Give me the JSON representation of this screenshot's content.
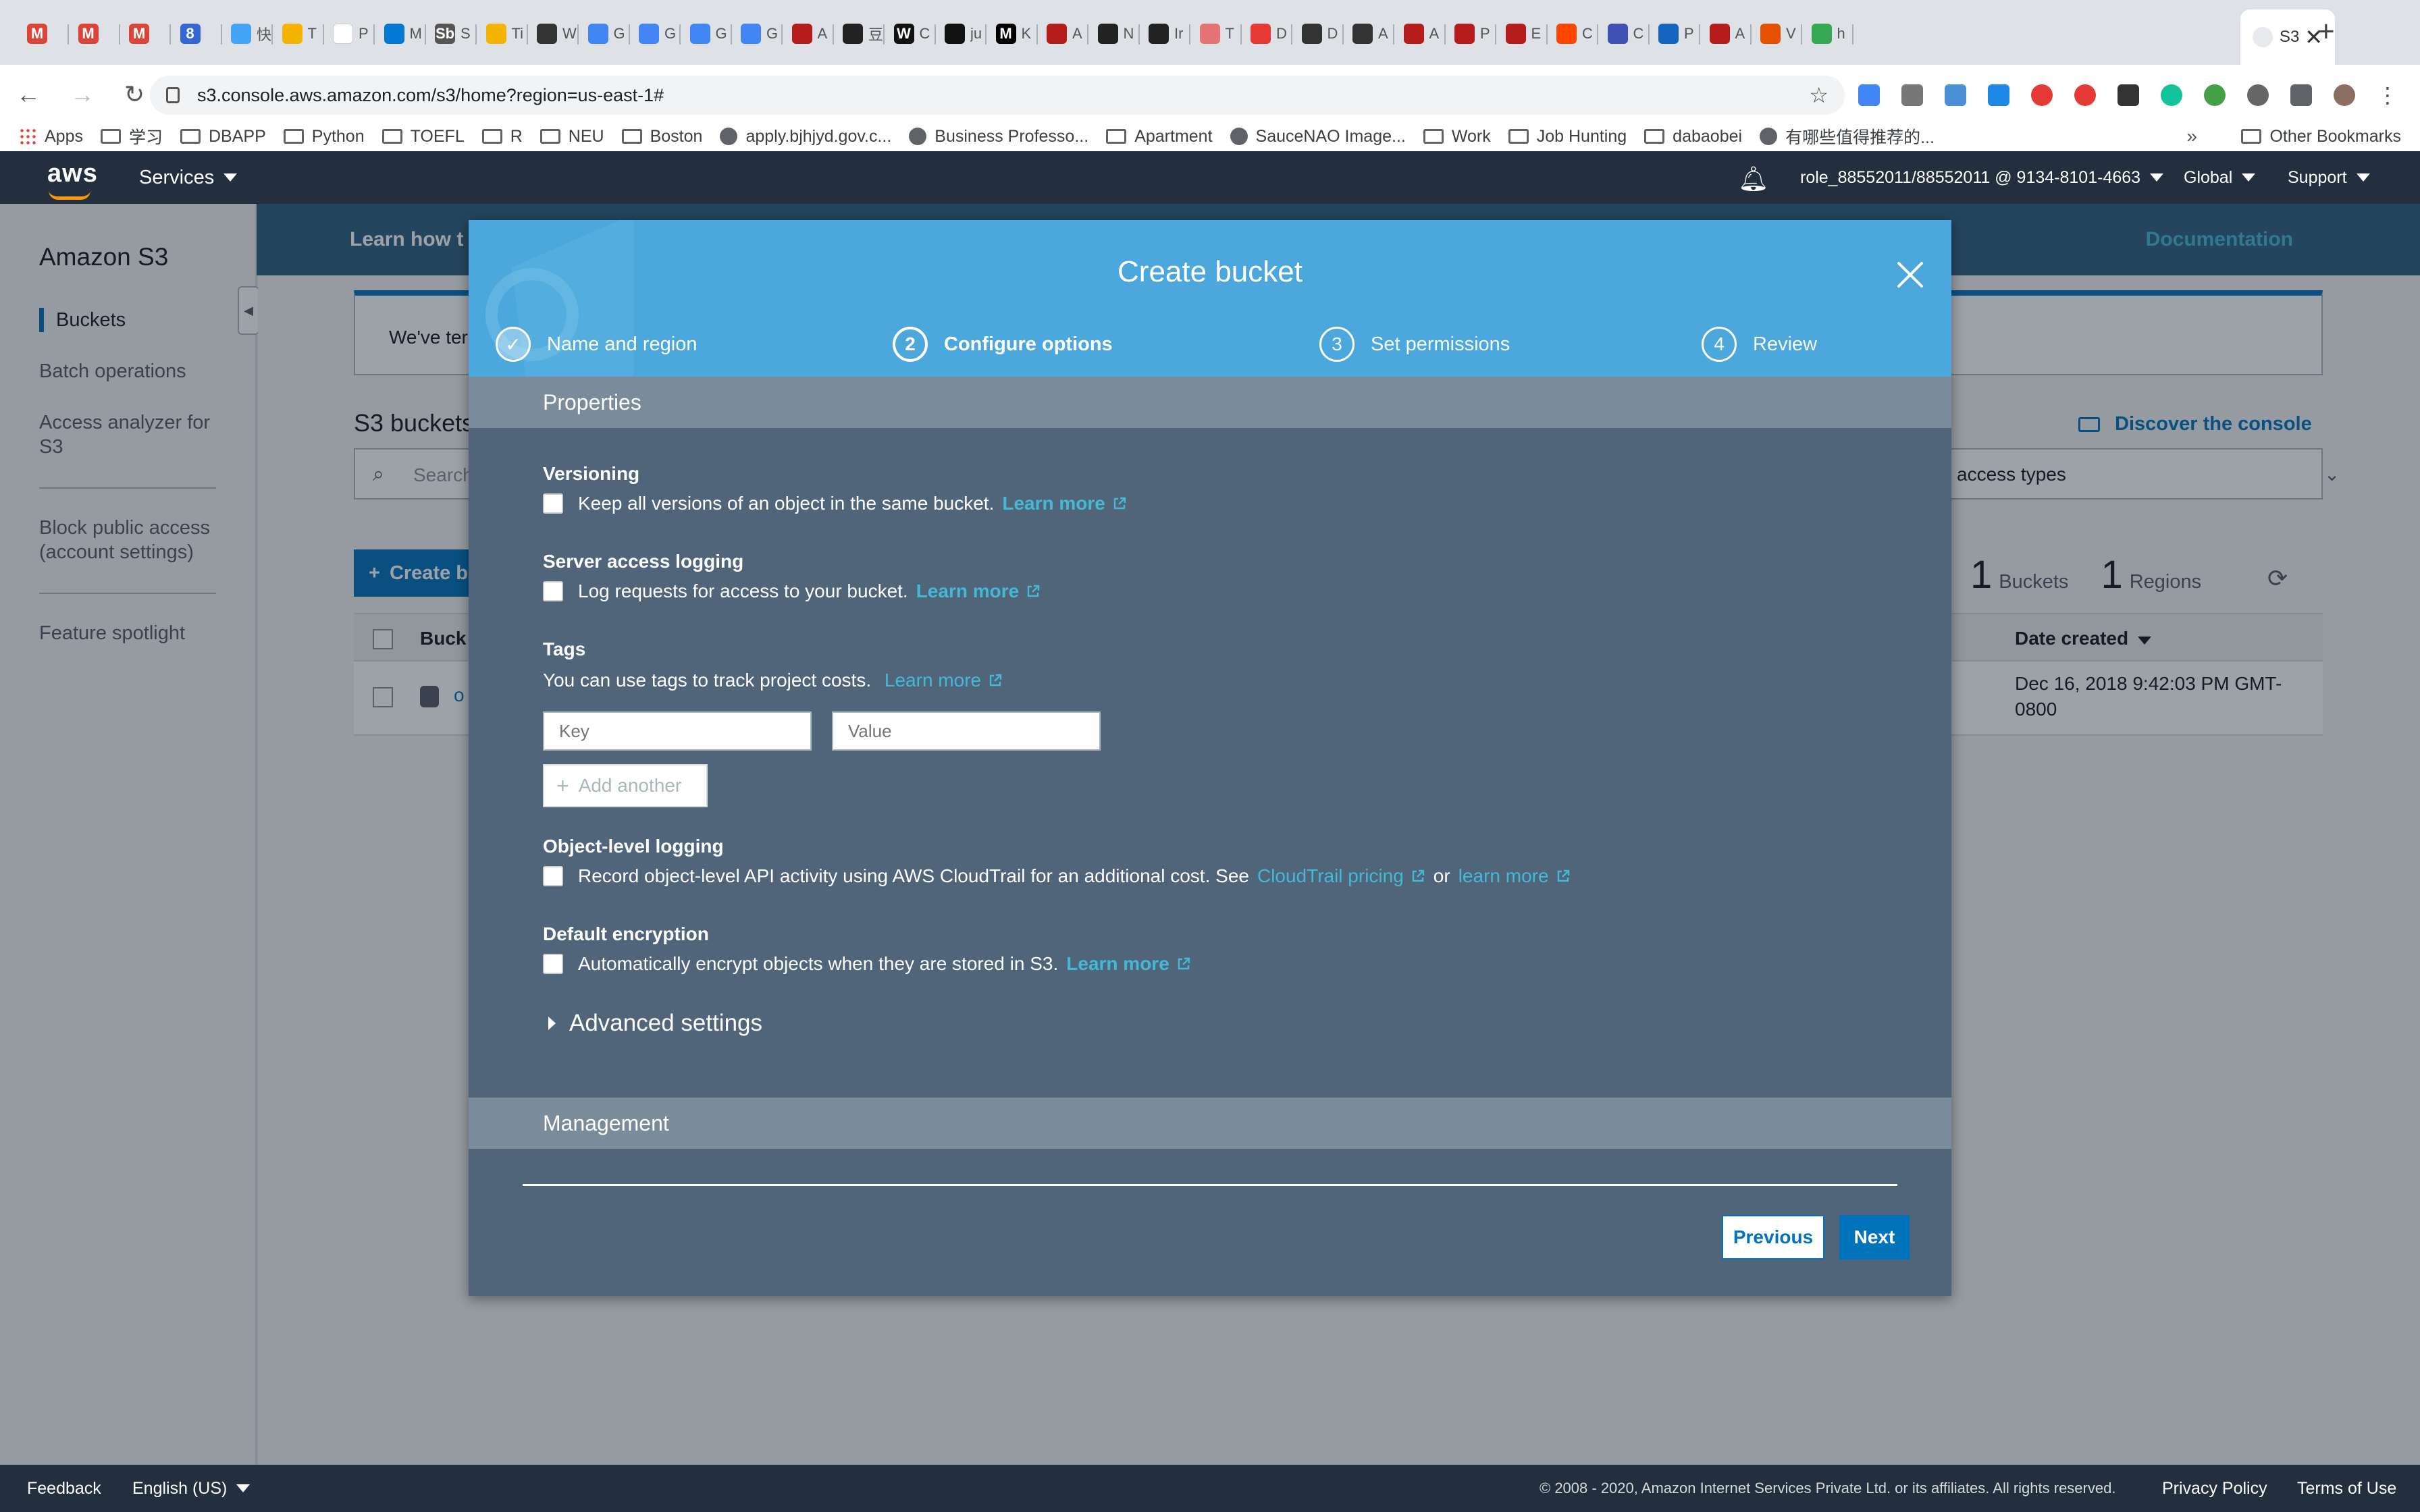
{
  "browser": {
    "tabs": [
      {
        "letter": "M",
        "title": "",
        "color": "#db4437"
      },
      {
        "letter": "M",
        "title": "",
        "color": "#db4437"
      },
      {
        "letter": "M",
        "title": "",
        "color": "#db4437"
      },
      {
        "letter": "8",
        "title": "",
        "color": "#3367d6"
      },
      {
        "letter": "",
        "title": "快",
        "color": "#42a5f5"
      },
      {
        "letter": "",
        "title": "T",
        "color": "#f4b400"
      },
      {
        "letter": "",
        "title": "P",
        "color": "#ffffff"
      },
      {
        "letter": "",
        "title": "M",
        "color": "#0078d4"
      },
      {
        "letter": "Sb",
        "title": "S",
        "color": "#555555"
      },
      {
        "letter": "",
        "title": "Ti",
        "color": "#f4b400"
      },
      {
        "letter": "",
        "title": "W",
        "color": "#333333"
      },
      {
        "letter": "",
        "title": "G",
        "color": "#4285f4"
      },
      {
        "letter": "",
        "title": "G",
        "color": "#4285f4"
      },
      {
        "letter": "",
        "title": "G",
        "color": "#4285f4"
      },
      {
        "letter": "",
        "title": "G",
        "color": "#4285f4"
      },
      {
        "letter": "",
        "title": "A",
        "color": "#b71c1c"
      },
      {
        "letter": "",
        "title": "豆",
        "color": "#222222"
      },
      {
        "letter": "W",
        "title": "C",
        "color": "#111111"
      },
      {
        "letter": "",
        "title": "ju",
        "color": "#111111"
      },
      {
        "letter": "M",
        "title": "K",
        "color": "#000000"
      },
      {
        "letter": "",
        "title": "A",
        "color": "#b71c1c"
      },
      {
        "letter": "",
        "title": "N",
        "color": "#222222"
      },
      {
        "letter": "",
        "title": "Ir",
        "color": "#222222"
      },
      {
        "letter": "",
        "title": "T",
        "color": "#e57373"
      },
      {
        "letter": "",
        "title": "D",
        "color": "#e53935"
      },
      {
        "letter": "",
        "title": "D",
        "color": "#333333"
      },
      {
        "letter": "",
        "title": "A",
        "color": "#333333"
      },
      {
        "letter": "",
        "title": "A",
        "color": "#b71c1c"
      },
      {
        "letter": "",
        "title": "P",
        "color": "#b71c1c"
      },
      {
        "letter": "",
        "title": "E",
        "color": "#b71c1c"
      },
      {
        "letter": "",
        "title": "C",
        "color": "#ff4500"
      },
      {
        "letter": "",
        "title": "C",
        "color": "#3f51b5"
      },
      {
        "letter": "",
        "title": "P",
        "color": "#1565c0"
      },
      {
        "letter": "",
        "title": "A",
        "color": "#b71c1c"
      },
      {
        "letter": "",
        "title": "V",
        "color": "#e65100"
      },
      {
        "letter": "",
        "title": "h",
        "color": "#34a853"
      }
    ],
    "active_tab": {
      "title": "S3"
    },
    "url": "s3.console.aws.amazon.com/s3/home?region=us-east-1#",
    "bookmarks": [
      {
        "label": "Apps",
        "type": "apps"
      },
      {
        "label": "学习",
        "type": "folder"
      },
      {
        "label": "DBAPP",
        "type": "folder"
      },
      {
        "label": "Python",
        "type": "folder"
      },
      {
        "label": "TOEFL",
        "type": "folder"
      },
      {
        "label": "R",
        "type": "folder"
      },
      {
        "label": "NEU",
        "type": "folder"
      },
      {
        "label": "Boston",
        "type": "folder"
      },
      {
        "label": "apply.bjhjyd.gov.c...",
        "type": "site"
      },
      {
        "label": "Business Professo...",
        "type": "site"
      },
      {
        "label": "Apartment",
        "type": "folder"
      },
      {
        "label": "SauceNAO Image...",
        "type": "site"
      },
      {
        "label": "Work",
        "type": "folder"
      },
      {
        "label": "Job Hunting",
        "type": "folder"
      },
      {
        "label": "dabaobei",
        "type": "folder"
      },
      {
        "label": "有哪些值得推荐的...",
        "type": "site"
      }
    ],
    "bookmarks_more": "»",
    "other_bookmarks": "Other Bookmarks"
  },
  "aws_header": {
    "logo": "aws",
    "services": "Services",
    "account": "role_88552011/88552011 @ 9134-8101-4663",
    "region": "Global",
    "support": "Support"
  },
  "sidebar": {
    "title": "Amazon S3",
    "items": [
      "Buckets",
      "Batch operations",
      "Access analyzer for S3",
      "Block public access (account settings)",
      "Feature spotlight"
    ]
  },
  "page": {
    "learn_banner": "Learn how t",
    "documentation": "Documentation",
    "info_text": "We've ter",
    "s3_buckets_heading": "S3 buckets",
    "discover": "Discover the console",
    "search_placeholder": "Search",
    "access_types": "access types",
    "create_bucket": "Create b",
    "buckets_count": "1",
    "buckets_label": "Buckets",
    "regions_count": "1",
    "regions_label": "Regions",
    "col_bucket": "Buck",
    "col_date": "Date created",
    "row_date": "Dec 16, 2018 9:42:03 PM GMT-0800",
    "row_name": "o"
  },
  "modal": {
    "title": "Create bucket",
    "steps": [
      {
        "num": "✓",
        "label": "Name and region",
        "state": "done"
      },
      {
        "num": "2",
        "label": "Configure options",
        "state": "current"
      },
      {
        "num": "3",
        "label": "Set permissions",
        "state": "pending"
      },
      {
        "num": "4",
        "label": "Review",
        "state": "pending"
      }
    ],
    "properties_header": "Properties",
    "versioning": {
      "title": "Versioning",
      "text": "Keep all versions of an object in the same bucket.",
      "link": "Learn more"
    },
    "logging": {
      "title": "Server access logging",
      "text": "Log requests for access to your bucket.",
      "link": "Learn more"
    },
    "tags": {
      "title": "Tags",
      "text": "You can use tags to track project costs.",
      "link": "Learn more",
      "key_placeholder": "Key",
      "value_placeholder": "Value",
      "add_another": "Add another"
    },
    "object_logging": {
      "title": "Object-level logging",
      "text": "Record object-level API activity using AWS CloudTrail for an additional cost. See",
      "link1": "CloudTrail pricing",
      "or": "or",
      "link2": "learn more"
    },
    "encryption": {
      "title": "Default encryption",
      "text": "Automatically encrypt objects when they are stored in S3.",
      "link": "Learn more"
    },
    "advanced_settings": "Advanced settings",
    "management_header": "Management",
    "previous": "Previous",
    "next": "Next"
  },
  "footer": {
    "feedback": "Feedback",
    "language": "English (US)",
    "copyright": "© 2008 - 2020, Amazon Internet Services Private Ltd. or its affiliates. All rights reserved.",
    "privacy": "Privacy Policy",
    "terms": "Terms of Use"
  },
  "colors": {
    "aws_dark": "#232f3e",
    "aws_orange": "#ff9900",
    "modal_header": "#4ca8dc",
    "modal_body": "#50657a",
    "primary": "#0073bb",
    "link": "#44b9d6"
  }
}
